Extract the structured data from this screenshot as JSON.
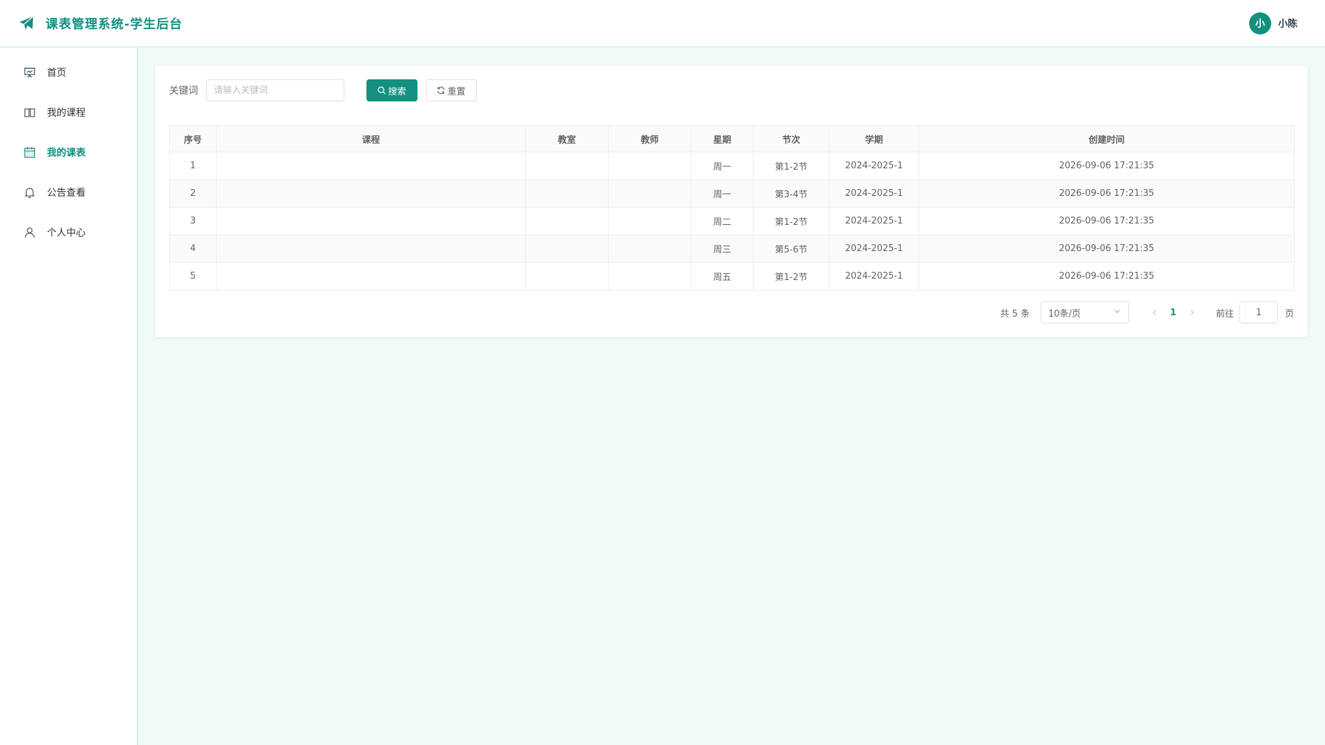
{
  "app": {
    "title": "课表管理系统-学生后台",
    "brand_color": "#138f80"
  },
  "user": {
    "avatar_text": "小",
    "name": "小陈"
  },
  "sidebar": {
    "items": [
      {
        "label": "首页",
        "icon": "presentation-icon",
        "active": false
      },
      {
        "label": "我的课程",
        "icon": "book-icon",
        "active": false
      },
      {
        "label": "我的课表",
        "icon": "calendar-icon",
        "active": true
      },
      {
        "label": "公告查看",
        "icon": "bell-icon",
        "active": false
      },
      {
        "label": "个人中心",
        "icon": "user-icon",
        "active": false
      }
    ]
  },
  "search": {
    "label": "关键词",
    "placeholder": "请输入关键词",
    "value": "",
    "search_label": "搜索",
    "reset_label": "重置"
  },
  "table": {
    "columns": [
      "序号",
      "课程",
      "教室",
      "教师",
      "星期",
      "节次",
      "学期",
      "创建时间"
    ],
    "rows": [
      [
        "1",
        "",
        "",
        "",
        "周一",
        "第1-2节",
        "2024-2025-1",
        "2026-09-06 17:21:35"
      ],
      [
        "2",
        "",
        "",
        "",
        "周一",
        "第3-4节",
        "2024-2025-1",
        "2026-09-06 17:21:35"
      ],
      [
        "3",
        "",
        "",
        "",
        "周二",
        "第1-2节",
        "2024-2025-1",
        "2026-09-06 17:21:35"
      ],
      [
        "4",
        "",
        "",
        "",
        "周三",
        "第5-6节",
        "2024-2025-1",
        "2026-09-06 17:21:35"
      ],
      [
        "5",
        "",
        "",
        "",
        "周五",
        "第1-2节",
        "2024-2025-1",
        "2026-09-06 17:21:35"
      ]
    ]
  },
  "pagination": {
    "total_text": "共 5 条",
    "page_size": "10条/页",
    "current_page": "1",
    "goto_label": "前往",
    "goto_value": "1",
    "page_unit": "页"
  }
}
